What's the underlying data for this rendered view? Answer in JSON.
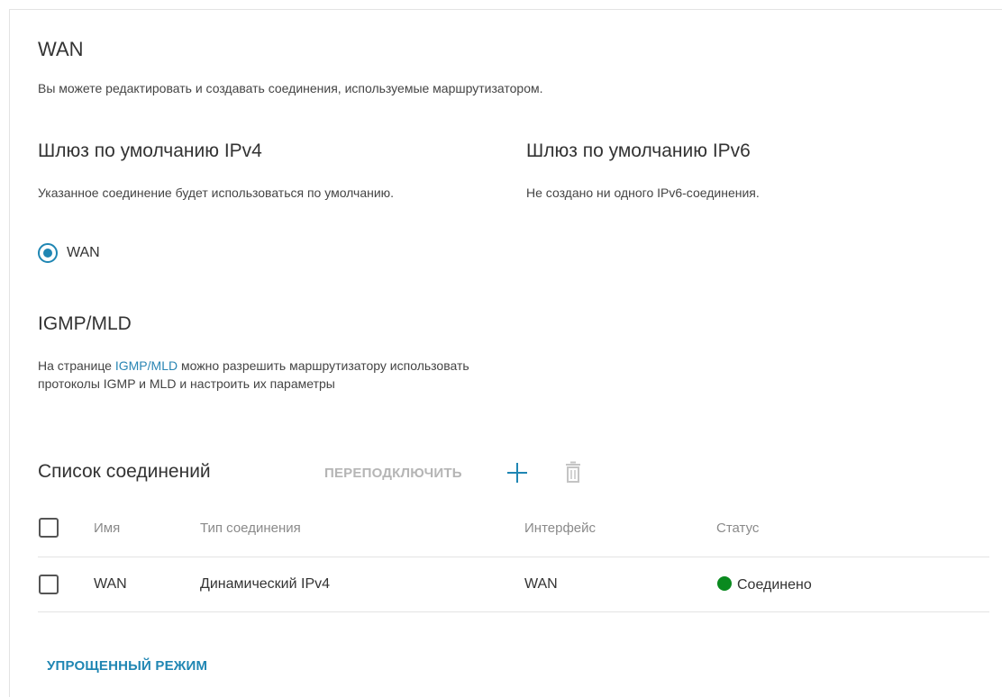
{
  "page": {
    "title": "WAN",
    "description": "Вы можете редактировать и создавать соединения, используемые маршрутизатором."
  },
  "ipv4": {
    "title": "Шлюз по умолчанию IPv4",
    "description": "Указанное соединение будет использоваться по умолчанию.",
    "radio_label": "WAN",
    "selected": true
  },
  "ipv6": {
    "title": "Шлюз по умолчанию IPv6",
    "description": "Не создано ни одного IPv6-соединения."
  },
  "igmp": {
    "title": "IGMP/MLD",
    "text_before": "На странице ",
    "link": "IGMP/MLD",
    "text_after": " можно разрешить маршрутизатору использовать протоколы IGMP и MLD и настроить их параметры"
  },
  "connections": {
    "title": "Список соединений",
    "reconnect_label": "ПЕРЕПОДКЛЮЧИТЬ",
    "add_icon": "plus-icon",
    "delete_icon": "trash-icon",
    "columns": [
      "Имя",
      "Тип соединения",
      "Интерфейс",
      "Статус"
    ],
    "rows": [
      {
        "name": "WAN",
        "type": "Динамический IPv4",
        "interface": "WAN",
        "status": "Соединено",
        "status_color": "#0a8a1f"
      }
    ]
  },
  "footer": {
    "simple_mode_label": "УПРОЩЕННЫЙ РЕЖИМ"
  },
  "colors": {
    "accent": "#1f86b3",
    "link": "#2a86b4",
    "disabled": "#b5b5b5",
    "status_connected": "#0a8a1f"
  }
}
